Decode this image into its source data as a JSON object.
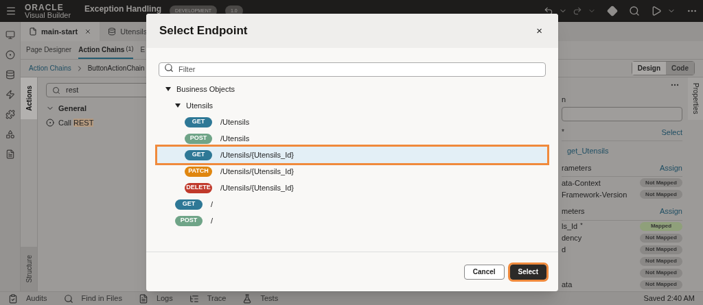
{
  "top_bar": {
    "brand_line1": "ORACLE",
    "brand_line2": "Visual Builder",
    "app_name": "Exception Handling",
    "badges": [
      "DEVELOPMENT",
      "1.0"
    ]
  },
  "file_tabs": [
    {
      "label": "main-start",
      "selected": true,
      "closable": true,
      "kind": "page"
    },
    {
      "label": "Utensils",
      "selected": false,
      "closable": false,
      "kind": "data"
    }
  ],
  "editor_tabs": [
    {
      "label": "Page Designer",
      "selected": false
    },
    {
      "label": "Action Chains",
      "count": "(1)",
      "selected": true
    },
    {
      "label": "E",
      "selected": false
    }
  ],
  "breadcrumb": [
    "Action Chains",
    "ButtonActionChain"
  ],
  "view_toggle": [
    {
      "label": "Design",
      "selected": true
    },
    {
      "label": "Code",
      "selected": false
    }
  ],
  "side_tabs": [
    {
      "label": "Actions",
      "selected": true
    },
    {
      "label": "Structure",
      "selected": false
    }
  ],
  "actions_panel": {
    "search": "rest",
    "group": "General",
    "expanded": true,
    "items": [
      {
        "prefix": "Call",
        "match": "REST"
      }
    ]
  },
  "properties_panel": {
    "field_label": "n",
    "endpoint": {
      "label": "*",
      "action": "Select",
      "value": "get_Utensils"
    },
    "sections": [
      {
        "title": "rameters",
        "action": "Assign",
        "params": [
          {
            "name": "ata-Context",
            "status": "Not Mapped",
            "mapped": false
          },
          {
            "name": "Framework-Version",
            "status": "Not Mapped",
            "mapped": false
          }
        ]
      },
      {
        "title": "meters",
        "action": "Assign",
        "params": [
          {
            "name": "ls_Id",
            "marker": "*",
            "status": "Mapped",
            "mapped": true
          },
          {
            "name": "dency",
            "status": "Not Mapped",
            "mapped": false
          },
          {
            "name": "d",
            "status": "Not Mapped",
            "mapped": false
          },
          {
            "status": "Not Mapped",
            "mapped": false
          },
          {
            "status": "Not Mapped",
            "mapped": false
          },
          {
            "name": "ata",
            "status": "Not Mapped",
            "mapped": false
          }
        ]
      }
    ]
  },
  "properties_tab": "Properties",
  "dialog": {
    "title": "Select Endpoint",
    "close": "×",
    "filter": {
      "placeholder": "Filter"
    },
    "tree": [
      {
        "kind": "group",
        "label": "Business Objects",
        "expanded": true,
        "children": [
          {
            "kind": "group",
            "label": "Utensils",
            "expanded": true,
            "children": [
              {
                "kind": "endpoint",
                "method": "GET",
                "color": "#2e7896",
                "path": "/Utensils",
                "selected": false
              },
              {
                "kind": "endpoint",
                "method": "POST",
                "color": "#6fa487",
                "path": "/Utensils",
                "selected": false
              },
              {
                "kind": "endpoint",
                "method": "GET",
                "color": "#2e7896",
                "path": "/Utensils/{Utensils_Id}",
                "selected": true
              },
              {
                "kind": "endpoint",
                "method": "PATCH",
                "color": "#e0860f",
                "path": "/Utensils/{Utensils_Id}",
                "selected": false
              },
              {
                "kind": "endpoint",
                "method": "DELETE",
                "color": "#c0392b",
                "path": "/Utensils/{Utensils_Id}",
                "selected": false
              }
            ]
          },
          {
            "kind": "endpoint",
            "method": "GET",
            "color": "#2e7896",
            "path": "/",
            "selected": false
          },
          {
            "kind": "endpoint",
            "method": "POST",
            "color": "#6fa487",
            "path": "/",
            "selected": false
          }
        ]
      }
    ],
    "buttons": [
      {
        "label": "Cancel",
        "primary": false,
        "highlighted": false
      },
      {
        "label": "Select",
        "primary": true,
        "highlighted": true
      }
    ]
  },
  "status_bar": {
    "items": [
      {
        "label": "Audits",
        "kind": "audits"
      },
      {
        "label": "Find in Files",
        "kind": "find"
      },
      {
        "label": "Logs",
        "kind": "logs"
      },
      {
        "label": "Trace",
        "kind": "trace"
      },
      {
        "label": "Tests",
        "kind": "tests"
      }
    ],
    "saved": "Saved 2:40 AM"
  }
}
